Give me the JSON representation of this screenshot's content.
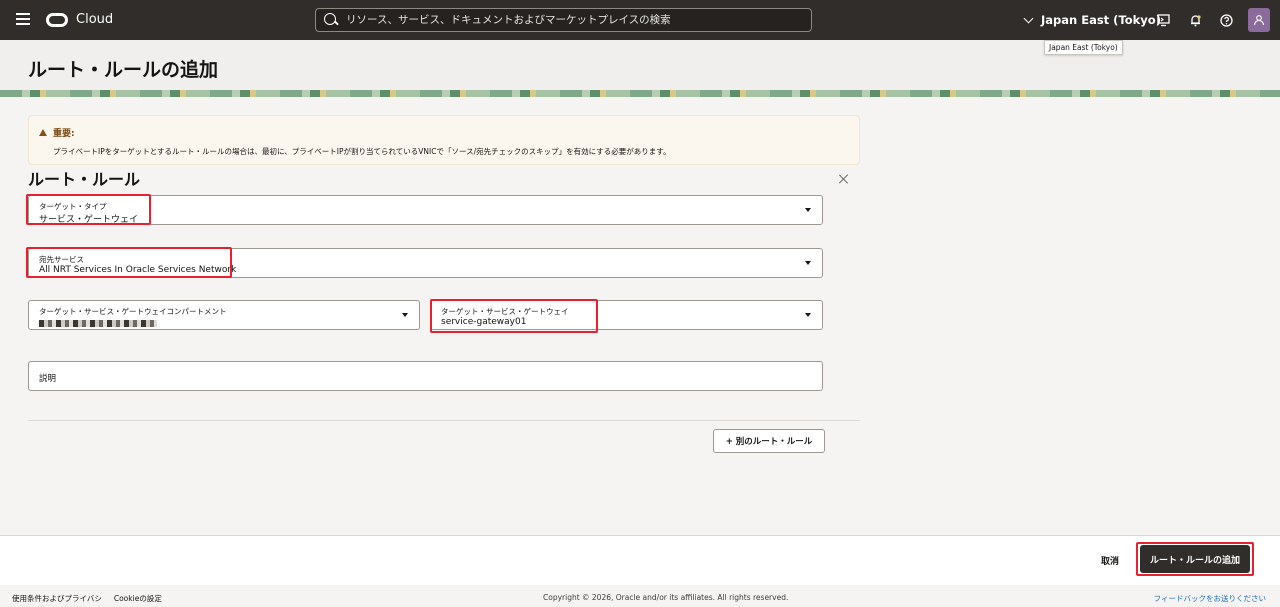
{
  "topbar": {
    "brand": "Cloud",
    "search_placeholder": "リソース、サービス、ドキュメントおよびマーケットプレイスの検索",
    "region": "Japan East (Tokyo)",
    "icons": [
      "menu-icon",
      "cloud-shell-icon",
      "notifications-icon",
      "help-icon",
      "profile-icon"
    ]
  },
  "tooltip": {
    "text": "Japan East (Tokyo)"
  },
  "page": {
    "title": "ルート・ルールの追加"
  },
  "warning": {
    "heading": "重要:",
    "body": "プライベートIPをターゲットとするルート・ルールの場合は、最初に、プライベートIPが割り当てられているVNICで「ソース/宛先チェックのスキップ」を有効にする必要があります。"
  },
  "section": {
    "title": "ルート・ルール"
  },
  "form": {
    "target_type": {
      "label": "ターゲット・タイプ",
      "value": "サービス・ゲートウェイ"
    },
    "destination_service": {
      "label": "宛先サービス",
      "value": "All NRT Services In Oracle Services Network"
    },
    "compartment": {
      "label": "ターゲット・サービス・ゲートウェイコンパートメント",
      "value": ""
    },
    "target_gateway": {
      "label": "ターゲット・サービス・ゲートウェイ",
      "value": "service-gateway01"
    },
    "description": {
      "label": "説明"
    }
  },
  "buttons": {
    "add_another": "+ 別のルート・ルール",
    "cancel": "取消",
    "submit": "ルート・ルールの追加"
  },
  "footer": {
    "terms": "使用条件およびプライバシ",
    "cookies": "Cookieの設定",
    "copyright": "Copyright © 2026, Oracle and/or its affiliates. All rights reserved.",
    "feedback": "フィードバックをお送りください"
  },
  "colors": {
    "topbar": "#312d2a",
    "highlight": "#e8212e",
    "link": "#1a6ec2"
  }
}
